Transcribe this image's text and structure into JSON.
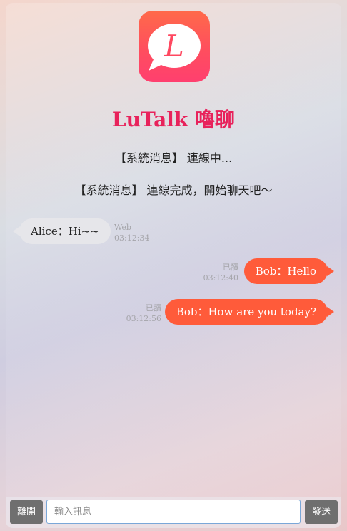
{
  "app": {
    "title": "LuTalk 嚕聊",
    "icon": "speech-bubble-L-logo",
    "icon_letter": "L",
    "accent_color": "#e8225b",
    "icon_gradient": [
      "#ff6a4a",
      "#ff3f6f"
    ]
  },
  "system_messages": [
    "【系統消息】 連線中...",
    "【系統消息】 連線完成，開始聊天吧～"
  ],
  "messages": [
    {
      "side": "left",
      "text": "Alice：Hi~~",
      "meta_top": "Web",
      "time": "03:12:34"
    },
    {
      "side": "right",
      "text": "Bob：Hello",
      "meta_top": "已讀",
      "time": "03:12:40"
    },
    {
      "side": "right",
      "text": "Bob：How are you today?",
      "meta_top": "已讀",
      "time": "03:12:56"
    }
  ],
  "input_bar": {
    "leave_label": "離開",
    "placeholder": "輸入訊息",
    "value": "",
    "send_label": "發送"
  },
  "colors": {
    "outgoing_bubble": "#ff5b3a",
    "incoming_bubble": "#e6e6ea",
    "button": "#6f6f6f"
  }
}
